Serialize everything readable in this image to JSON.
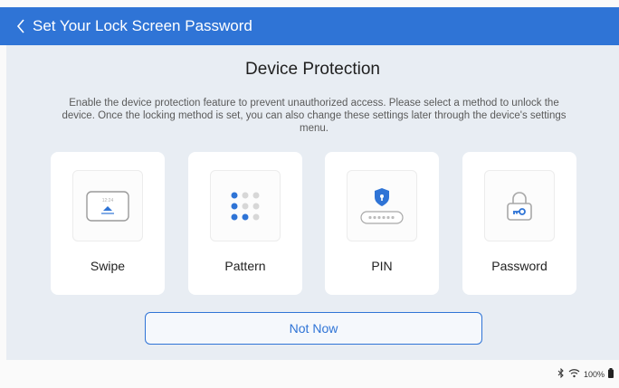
{
  "header": {
    "title": "Set Your Lock Screen Password",
    "back_icon": "chevron-left-icon"
  },
  "main": {
    "title": "Device Protection",
    "description": "Enable the device protection feature to prevent unauthorized access. Please select a method to unlock the device. Once the locking method is set, you can also change these settings later through the device's settings menu."
  },
  "methods": [
    {
      "label": "Swipe",
      "icon": "swipe-icon",
      "clock_text": "12:24"
    },
    {
      "label": "Pattern",
      "icon": "pattern-icon"
    },
    {
      "label": "PIN",
      "icon": "pin-icon"
    },
    {
      "label": "Password",
      "icon": "password-icon"
    }
  ],
  "actions": {
    "not_now_label": "Not Now"
  },
  "status": {
    "battery": "100%",
    "bluetooth_icon": "bluetooth-icon",
    "wifi_icon": "wifi-icon",
    "battery_icon": "battery-icon"
  },
  "colors": {
    "accent": "#2f74d6",
    "panel": "#e8edf3"
  }
}
